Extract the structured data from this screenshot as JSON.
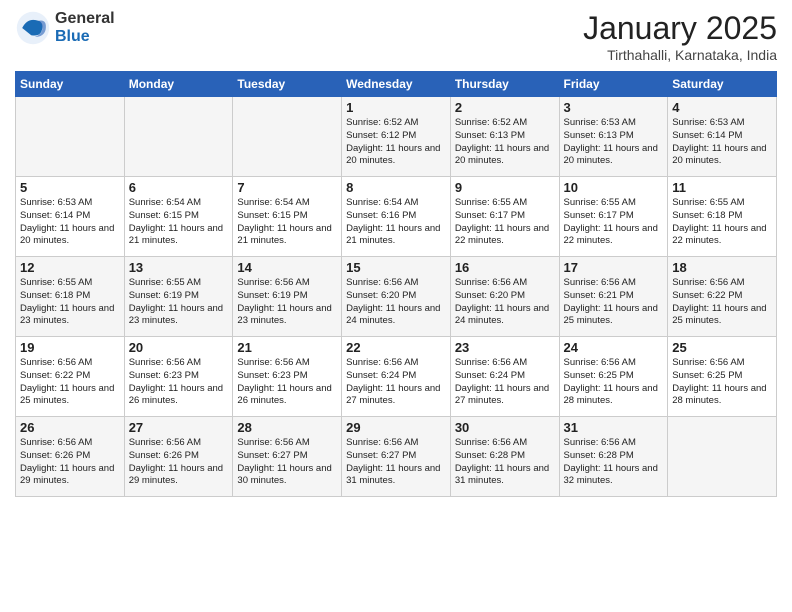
{
  "header": {
    "logo": {
      "general": "General",
      "blue": "Blue"
    },
    "title": "January 2025",
    "location": "Tirthahalli, Karnataka, India"
  },
  "weekdays": [
    "Sunday",
    "Monday",
    "Tuesday",
    "Wednesday",
    "Thursday",
    "Friday",
    "Saturday"
  ],
  "weeks": [
    [
      {
        "day": "",
        "sunrise": "",
        "sunset": "",
        "daylight": ""
      },
      {
        "day": "",
        "sunrise": "",
        "sunset": "",
        "daylight": ""
      },
      {
        "day": "",
        "sunrise": "",
        "sunset": "",
        "daylight": ""
      },
      {
        "day": "1",
        "sunrise": "Sunrise: 6:52 AM",
        "sunset": "Sunset: 6:12 PM",
        "daylight": "Daylight: 11 hours and 20 minutes."
      },
      {
        "day": "2",
        "sunrise": "Sunrise: 6:52 AM",
        "sunset": "Sunset: 6:13 PM",
        "daylight": "Daylight: 11 hours and 20 minutes."
      },
      {
        "day": "3",
        "sunrise": "Sunrise: 6:53 AM",
        "sunset": "Sunset: 6:13 PM",
        "daylight": "Daylight: 11 hours and 20 minutes."
      },
      {
        "day": "4",
        "sunrise": "Sunrise: 6:53 AM",
        "sunset": "Sunset: 6:14 PM",
        "daylight": "Daylight: 11 hours and 20 minutes."
      }
    ],
    [
      {
        "day": "5",
        "sunrise": "Sunrise: 6:53 AM",
        "sunset": "Sunset: 6:14 PM",
        "daylight": "Daylight: 11 hours and 20 minutes."
      },
      {
        "day": "6",
        "sunrise": "Sunrise: 6:54 AM",
        "sunset": "Sunset: 6:15 PM",
        "daylight": "Daylight: 11 hours and 21 minutes."
      },
      {
        "day": "7",
        "sunrise": "Sunrise: 6:54 AM",
        "sunset": "Sunset: 6:15 PM",
        "daylight": "Daylight: 11 hours and 21 minutes."
      },
      {
        "day": "8",
        "sunrise": "Sunrise: 6:54 AM",
        "sunset": "Sunset: 6:16 PM",
        "daylight": "Daylight: 11 hours and 21 minutes."
      },
      {
        "day": "9",
        "sunrise": "Sunrise: 6:55 AM",
        "sunset": "Sunset: 6:17 PM",
        "daylight": "Daylight: 11 hours and 22 minutes."
      },
      {
        "day": "10",
        "sunrise": "Sunrise: 6:55 AM",
        "sunset": "Sunset: 6:17 PM",
        "daylight": "Daylight: 11 hours and 22 minutes."
      },
      {
        "day": "11",
        "sunrise": "Sunrise: 6:55 AM",
        "sunset": "Sunset: 6:18 PM",
        "daylight": "Daylight: 11 hours and 22 minutes."
      }
    ],
    [
      {
        "day": "12",
        "sunrise": "Sunrise: 6:55 AM",
        "sunset": "Sunset: 6:18 PM",
        "daylight": "Daylight: 11 hours and 23 minutes."
      },
      {
        "day": "13",
        "sunrise": "Sunrise: 6:55 AM",
        "sunset": "Sunset: 6:19 PM",
        "daylight": "Daylight: 11 hours and 23 minutes."
      },
      {
        "day": "14",
        "sunrise": "Sunrise: 6:56 AM",
        "sunset": "Sunset: 6:19 PM",
        "daylight": "Daylight: 11 hours and 23 minutes."
      },
      {
        "day": "15",
        "sunrise": "Sunrise: 6:56 AM",
        "sunset": "Sunset: 6:20 PM",
        "daylight": "Daylight: 11 hours and 24 minutes."
      },
      {
        "day": "16",
        "sunrise": "Sunrise: 6:56 AM",
        "sunset": "Sunset: 6:20 PM",
        "daylight": "Daylight: 11 hours and 24 minutes."
      },
      {
        "day": "17",
        "sunrise": "Sunrise: 6:56 AM",
        "sunset": "Sunset: 6:21 PM",
        "daylight": "Daylight: 11 hours and 25 minutes."
      },
      {
        "day": "18",
        "sunrise": "Sunrise: 6:56 AM",
        "sunset": "Sunset: 6:22 PM",
        "daylight": "Daylight: 11 hours and 25 minutes."
      }
    ],
    [
      {
        "day": "19",
        "sunrise": "Sunrise: 6:56 AM",
        "sunset": "Sunset: 6:22 PM",
        "daylight": "Daylight: 11 hours and 25 minutes."
      },
      {
        "day": "20",
        "sunrise": "Sunrise: 6:56 AM",
        "sunset": "Sunset: 6:23 PM",
        "daylight": "Daylight: 11 hours and 26 minutes."
      },
      {
        "day": "21",
        "sunrise": "Sunrise: 6:56 AM",
        "sunset": "Sunset: 6:23 PM",
        "daylight": "Daylight: 11 hours and 26 minutes."
      },
      {
        "day": "22",
        "sunrise": "Sunrise: 6:56 AM",
        "sunset": "Sunset: 6:24 PM",
        "daylight": "Daylight: 11 hours and 27 minutes."
      },
      {
        "day": "23",
        "sunrise": "Sunrise: 6:56 AM",
        "sunset": "Sunset: 6:24 PM",
        "daylight": "Daylight: 11 hours and 27 minutes."
      },
      {
        "day": "24",
        "sunrise": "Sunrise: 6:56 AM",
        "sunset": "Sunset: 6:25 PM",
        "daylight": "Daylight: 11 hours and 28 minutes."
      },
      {
        "day": "25",
        "sunrise": "Sunrise: 6:56 AM",
        "sunset": "Sunset: 6:25 PM",
        "daylight": "Daylight: 11 hours and 28 minutes."
      }
    ],
    [
      {
        "day": "26",
        "sunrise": "Sunrise: 6:56 AM",
        "sunset": "Sunset: 6:26 PM",
        "daylight": "Daylight: 11 hours and 29 minutes."
      },
      {
        "day": "27",
        "sunrise": "Sunrise: 6:56 AM",
        "sunset": "Sunset: 6:26 PM",
        "daylight": "Daylight: 11 hours and 29 minutes."
      },
      {
        "day": "28",
        "sunrise": "Sunrise: 6:56 AM",
        "sunset": "Sunset: 6:27 PM",
        "daylight": "Daylight: 11 hours and 30 minutes."
      },
      {
        "day": "29",
        "sunrise": "Sunrise: 6:56 AM",
        "sunset": "Sunset: 6:27 PM",
        "daylight": "Daylight: 11 hours and 31 minutes."
      },
      {
        "day": "30",
        "sunrise": "Sunrise: 6:56 AM",
        "sunset": "Sunset: 6:28 PM",
        "daylight": "Daylight: 11 hours and 31 minutes."
      },
      {
        "day": "31",
        "sunrise": "Sunrise: 6:56 AM",
        "sunset": "Sunset: 6:28 PM",
        "daylight": "Daylight: 11 hours and 32 minutes."
      },
      {
        "day": "",
        "sunrise": "",
        "sunset": "",
        "daylight": ""
      }
    ]
  ]
}
